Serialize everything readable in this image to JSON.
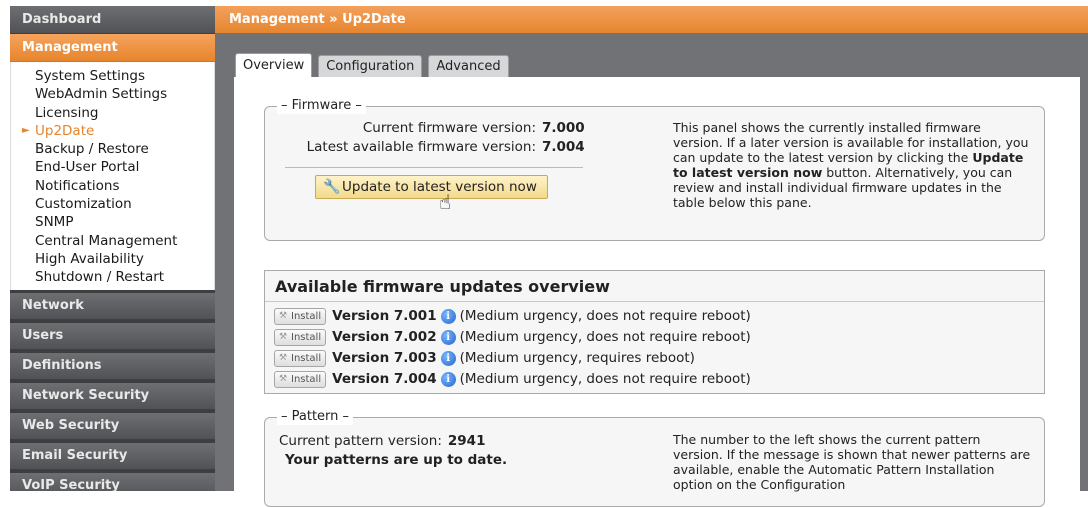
{
  "sidebar": {
    "dashboard": "Dashboard",
    "management": "Management",
    "items": [
      {
        "label": "System Settings",
        "active": false
      },
      {
        "label": "WebAdmin Settings",
        "active": false
      },
      {
        "label": "Licensing",
        "active": false
      },
      {
        "label": "Up2Date",
        "active": true
      },
      {
        "label": "Backup / Restore",
        "active": false
      },
      {
        "label": "End-User Portal",
        "active": false
      },
      {
        "label": "Notifications",
        "active": false
      },
      {
        "label": "Customization",
        "active": false
      },
      {
        "label": "SNMP",
        "active": false
      },
      {
        "label": "Central Management",
        "active": false
      },
      {
        "label": "High Availability",
        "active": false
      },
      {
        "label": "Shutdown / Restart",
        "active": false
      }
    ],
    "sections": [
      "Network",
      "Users",
      "Definitions",
      "Network Security",
      "Web Security",
      "Email Security",
      "VoIP Security"
    ]
  },
  "header": {
    "title": "Management » Up2Date"
  },
  "tabs": [
    "Overview",
    "Configuration",
    "Advanced"
  ],
  "firmware": {
    "legend": "Firmware",
    "current_label": "Current firmware version:",
    "current_value": "7.000",
    "latest_label": "Latest available firmware version:",
    "latest_value": "7.004",
    "update_button": "Update to latest version now",
    "desc_1": "This panel shows the currently installed firmware version. If a later version is available for installation, you can update to the latest version by clicking the ",
    "desc_bold": "Update to latest version now",
    "desc_2": " button. Alternatively, you can review and install individual firmware updates in the table below this pane."
  },
  "updates": {
    "title": "Available firmware updates overview",
    "install_label": "Install",
    "rows": [
      {
        "version": "Version 7.001",
        "note": "(Medium urgency, does not require reboot)"
      },
      {
        "version": "Version 7.002",
        "note": "(Medium urgency, does not require reboot)"
      },
      {
        "version": "Version 7.003",
        "note": "(Medium urgency, requires reboot)"
      },
      {
        "version": "Version 7.004",
        "note": "(Medium urgency, does not require reboot)"
      }
    ]
  },
  "pattern": {
    "legend": "Pattern",
    "current_label": "Current pattern version:",
    "current_value": "2941",
    "status": "Your patterns are up to date.",
    "desc": "The number to the left shows the current pattern version. If the message is shown that newer patterns are available, enable the Automatic Pattern Installation option on the Configuration"
  },
  "colors": {
    "accent_orange": "#e7852d",
    "sidebar_dark": "#505255",
    "info_blue": "#1f66c9"
  }
}
